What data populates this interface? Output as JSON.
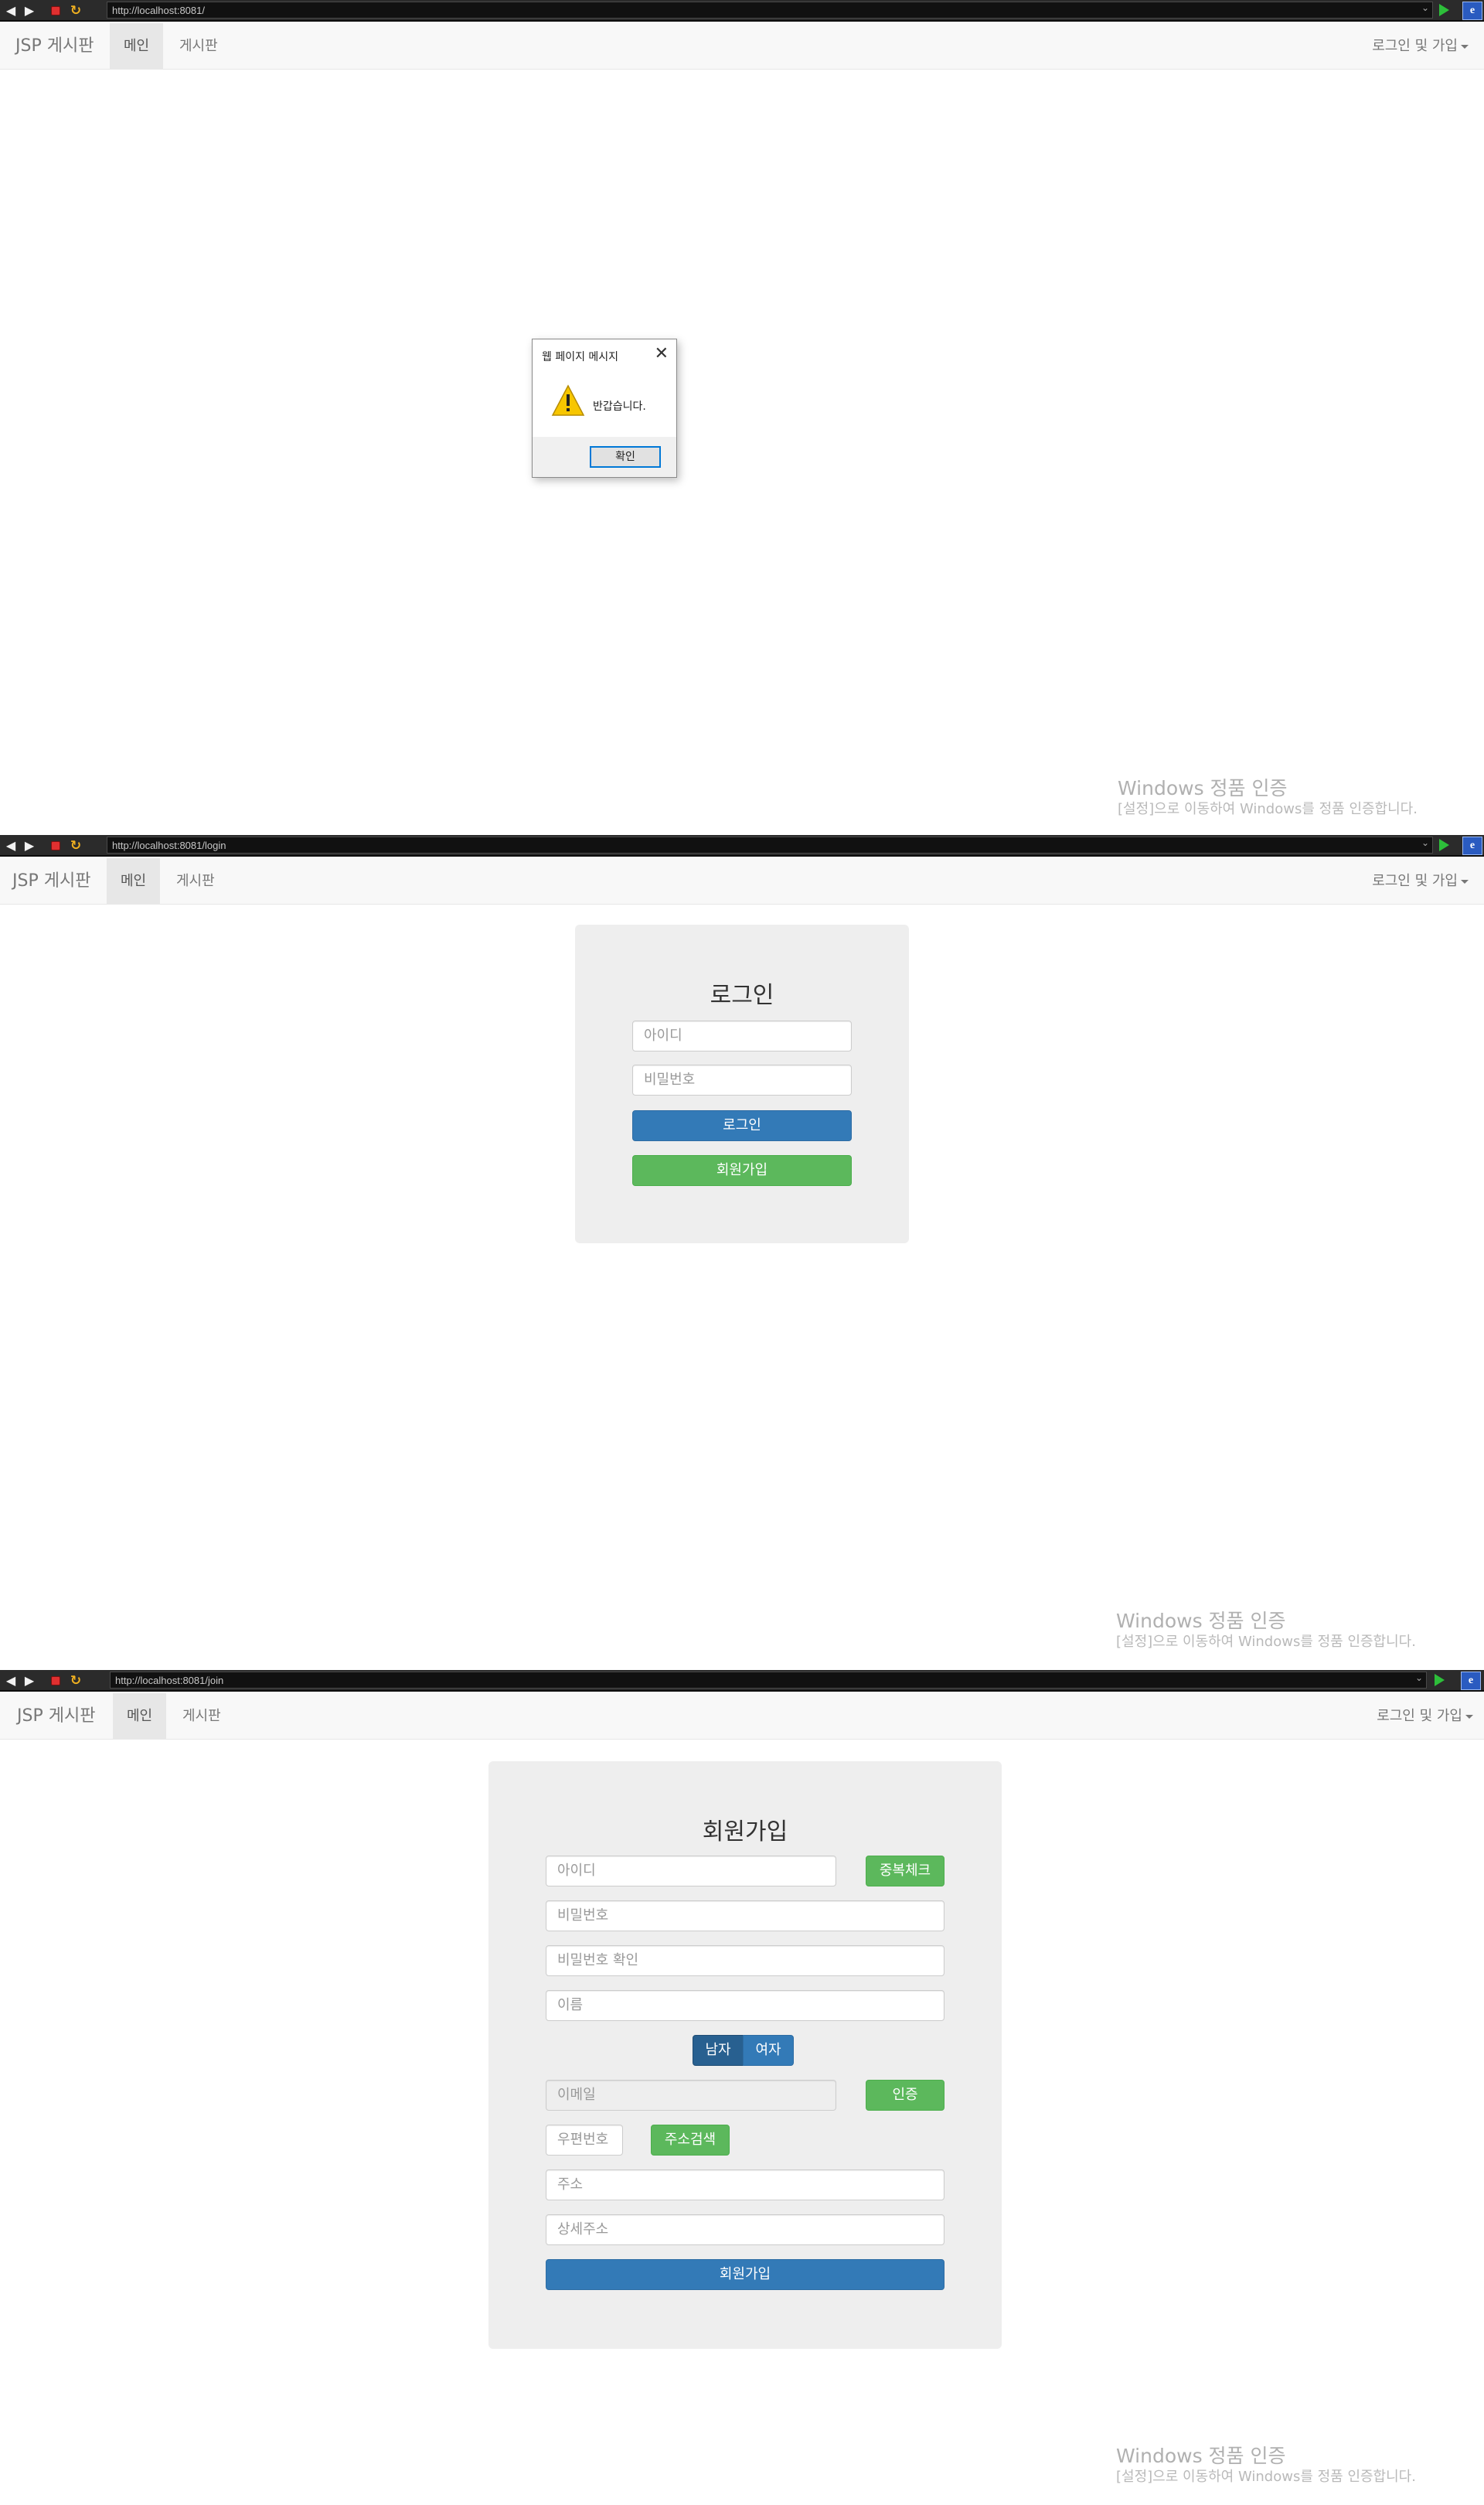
{
  "browser": {
    "url_main": "http://localhost:8081/",
    "url_login": "http://localhost:8081/login",
    "url_join": "http://localhost:8081/join",
    "back_icon": "arrow-left",
    "forward_icon": "arrow-right",
    "stop_icon": "stop-square",
    "refresh_icon": "refresh-arrows",
    "go_icon": "play-triangle",
    "ie_icon": "e"
  },
  "navbar": {
    "brand": "JSP 게시판",
    "items": [
      {
        "label": "메인",
        "active": true
      },
      {
        "label": "게시판",
        "active": false
      }
    ],
    "dropdown": "로그인 및 가입"
  },
  "alert": {
    "title": "웹 페이지 메시지",
    "message": "반갑습니다.",
    "ok": "확인",
    "icon": "warning-triangle"
  },
  "login": {
    "title": "로그인",
    "id_placeholder": "아이디",
    "pw_placeholder": "비밀번호",
    "login_button": "로그인",
    "join_button": "회원가입"
  },
  "join": {
    "title": "회원가입",
    "id_placeholder": "아이디",
    "dup_check": "중복체크",
    "pw_placeholder": "비밀번호",
    "pw_confirm_placeholder": "비밀번호 확인",
    "name_placeholder": "이름",
    "gender": [
      "남자",
      "여자"
    ],
    "email_placeholder": "이메일",
    "verify": "인증",
    "zipcode_placeholder": "우편번호",
    "address_search": "주소검색",
    "address_placeholder": "주소",
    "detail_address_placeholder": "상세주소",
    "submit": "회원가입"
  },
  "watermark": {
    "title": "Windows 정품 인증",
    "subtitle": "[설정]으로 이동하여 Windows를 정품 인증합니다."
  },
  "colors": {
    "primary": "#337ab7",
    "success": "#5cb85c",
    "navbar_bg": "#f8f8f8",
    "jumbotron_bg": "#eeeeee"
  }
}
